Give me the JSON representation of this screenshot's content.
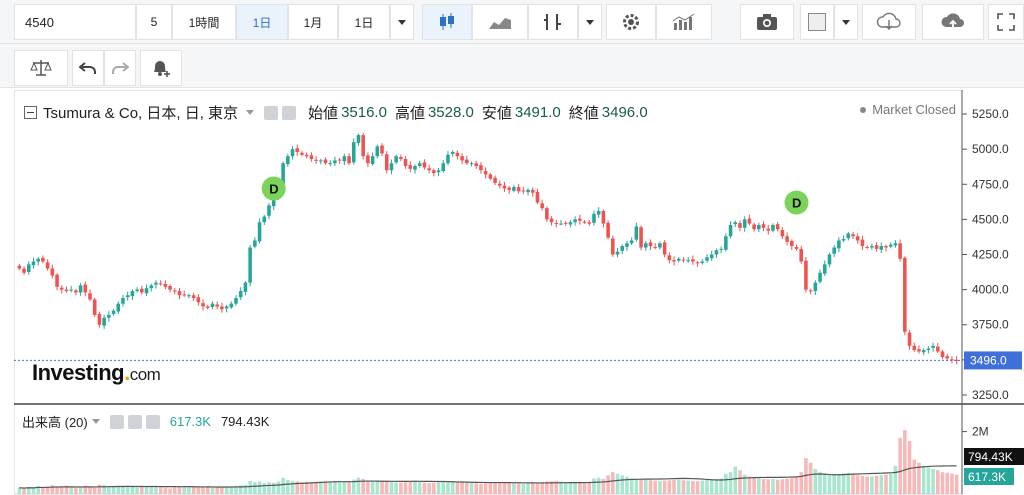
{
  "toolbar": {
    "symbol": "4540",
    "interval_5": "5",
    "interval_1h": "1時間",
    "interval_1d": "1日",
    "interval_1m": "1月",
    "range": "1日"
  },
  "legend": {
    "title": "Tsumura & Co, 日本, 日, 東京",
    "open_label": "始値",
    "open": "3516.0",
    "high_label": "高値",
    "high": "3528.0",
    "low_label": "安値",
    "low": "3491.0",
    "close_label": "終値",
    "close": "3496.0",
    "status": "Market Closed"
  },
  "volume_legend": {
    "title": "出来高 (20)",
    "value1": "617.3K",
    "value2": "794.43K"
  },
  "logo": {
    "main": "Investing",
    "suffix": "com"
  },
  "chart_data": {
    "type": "candlestick",
    "y_axis_ticks": [
      "5250.0",
      "5000.0",
      "4750.0",
      "4500.0",
      "4250.0",
      "4000.0",
      "3750.0",
      "3500.0",
      "3250.0"
    ],
    "ylim": [
      3200,
      5350
    ],
    "last_price_label": "3496.0",
    "volume_ticks": [
      "2M"
    ],
    "volume_labels": [
      "794.43K",
      "617.3K"
    ],
    "volume_ylim": [
      0,
      2500000
    ],
    "dividend_markers": [
      {
        "label": "D",
        "index": 54,
        "price": 4720
      },
      {
        "label": "D",
        "index": 165,
        "price": 4620
      }
    ],
    "closes": [
      4150,
      4120,
      4180,
      4200,
      4220,
      4200,
      4150,
      4100,
      4020,
      4000,
      3990,
      4000,
      3980,
      4030,
      3980,
      3930,
      3820,
      3750,
      3800,
      3820,
      3850,
      3900,
      3940,
      3960,
      3990,
      4000,
      3980,
      4010,
      4030,
      4050,
      4040,
      4020,
      4000,
      3990,
      3960,
      3960,
      3960,
      3940,
      3910,
      3880,
      3870,
      3900,
      3880,
      3860,
      3880,
      3900,
      3940,
      3990,
      4050,
      4300,
      4350,
      4480,
      4520,
      4600,
      4650,
      4750,
      4900,
      4950,
      5000,
      4980,
      4960,
      4950,
      4930,
      4920,
      4920,
      4900,
      4900,
      4920,
      4920,
      4950,
      4900,
      5050,
      5100,
      4950,
      4900,
      4950,
      5020,
      4970,
      4850,
      4900,
      4950,
      4930,
      4880,
      4860,
      4880,
      4900,
      4870,
      4850,
      4830,
      4850,
      4900,
      4960,
      4980,
      4950,
      4920,
      4900,
      4900,
      4880,
      4850,
      4820,
      4790,
      4760,
      4740,
      4720,
      4710,
      4730,
      4700,
      4700,
      4710,
      4690,
      4620,
      4580,
      4500,
      4480,
      4470,
      4470,
      4470,
      4480,
      4500,
      4490,
      4480,
      4470,
      4540,
      4560,
      4470,
      4370,
      4250,
      4270,
      4310,
      4330,
      4350,
      4450,
      4300,
      4330,
      4310,
      4300,
      4330,
      4250,
      4210,
      4200,
      4220,
      4210,
      4210,
      4200,
      4190,
      4200,
      4230,
      4250,
      4280,
      4290,
      4380,
      4460,
      4480,
      4440,
      4500,
      4470,
      4430,
      4460,
      4440,
      4420,
      4460,
      4430,
      4380,
      4340,
      4310,
      4290,
      4200,
      4000,
      3990,
      4050,
      4120,
      4180,
      4250,
      4300,
      4350,
      4360,
      4400,
      4380,
      4350,
      4310,
      4300,
      4310,
      4290,
      4310,
      4300,
      4320,
      4330,
      4220,
      3700,
      3600,
      3570,
      3560,
      3570,
      3580,
      3600,
      3560,
      3520,
      3510,
      3500,
      3496
    ],
    "volumes": [
      200000,
      180000,
      220000,
      190000,
      260000,
      210000,
      240000,
      280000,
      230000,
      250000,
      270000,
      210000,
      190000,
      240000,
      260000,
      220000,
      200000,
      300000,
      280000,
      250000,
      230000,
      260000,
      240000,
      250000,
      220000,
      210000,
      230000,
      240000,
      260000,
      250000,
      220000,
      200000,
      180000,
      210000,
      240000,
      230000,
      210000,
      220000,
      200000,
      230000,
      250000,
      240000,
      220000,
      210000,
      230000,
      240000,
      260000,
      280000,
      300000,
      420000,
      380000,
      400000,
      350000,
      380000,
      360000,
      400000,
      520000,
      450000,
      420000,
      400000,
      380000,
      390000,
      370000,
      360000,
      380000,
      400000,
      390000,
      380000,
      370000,
      400000,
      380000,
      460000,
      520000,
      480000,
      430000,
      420000,
      440000,
      410000,
      390000,
      380000,
      370000,
      360000,
      380000,
      390000,
      400000,
      380000,
      360000,
      350000,
      360000,
      370000,
      380000,
      400000,
      390000,
      380000,
      370000,
      360000,
      350000,
      340000,
      330000,
      340000,
      350000,
      360000,
      380000,
      370000,
      360000,
      340000,
      330000,
      320000,
      330000,
      340000,
      360000,
      380000,
      400000,
      410000,
      420000,
      400000,
      380000,
      370000,
      360000,
      350000,
      370000,
      380000,
      500000,
      520000,
      480000,
      600000,
      700000,
      650000,
      600000,
      550000,
      500000,
      480000,
      460000,
      450000,
      440000,
      430000,
      420000,
      430000,
      440000,
      450000,
      460000,
      440000,
      430000,
      420000,
      410000,
      430000,
      450000,
      460000,
      480000,
      500000,
      650000,
      700000,
      880000,
      760000,
      620000,
      560000,
      540000,
      500000,
      480000,
      470000,
      480000,
      460000,
      470000,
      490000,
      510000,
      530000,
      700000,
      1150000,
      1000000,
      800000,
      700000,
      640000,
      600000,
      620000,
      640000,
      660000,
      680000,
      640000,
      600000,
      580000,
      560000,
      560000,
      580000,
      600000,
      620000,
      640000,
      900000,
      1800000,
      2050000,
      1700000,
      1100000,
      1000000,
      900000,
      850000,
      800000,
      760000,
      700000,
      680000,
      650000,
      617300
    ]
  },
  "colors": {
    "up": "#26a69a",
    "down": "#ef5350",
    "vol_up": "#a8e6cf",
    "vol_down": "#f7b8b8",
    "accent": "#2a72c5",
    "last_price_bg": "#3f6fd8"
  }
}
